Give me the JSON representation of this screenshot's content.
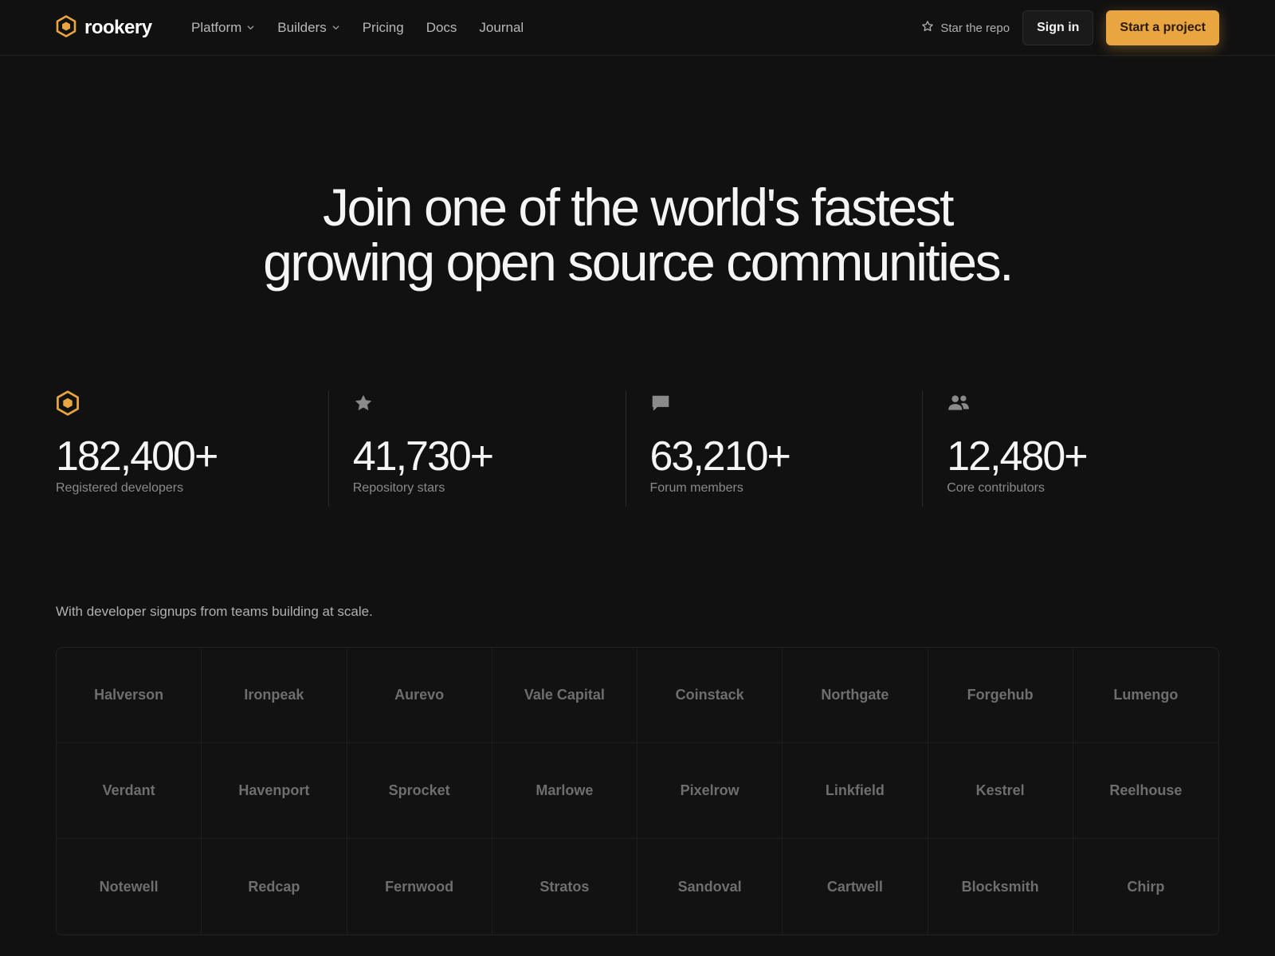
{
  "brand": {
    "name": "rookery",
    "accent": "#e9a53f"
  },
  "nav": {
    "links": [
      {
        "label": "Platform",
        "has_dropdown": true
      },
      {
        "label": "Builders",
        "has_dropdown": true
      },
      {
        "label": "Pricing",
        "has_dropdown": false
      },
      {
        "label": "Docs",
        "has_dropdown": false
      },
      {
        "label": "Journal",
        "has_dropdown": false
      }
    ],
    "star_label": "Star the repo",
    "signin_label": "Sign in",
    "cta_label": "Start a project"
  },
  "hero": {
    "line1": "Join one of the world's fastest",
    "line2": "growing open source communities."
  },
  "stats": [
    {
      "icon": "hexagon-logo-icon",
      "value": "182,400+",
      "label": "Registered developers"
    },
    {
      "icon": "star-icon",
      "value": "41,730+",
      "label": "Repository stars"
    },
    {
      "icon": "chat-bubble-icon",
      "value": "63,210+",
      "label": "Forum members"
    },
    {
      "icon": "users-icon",
      "value": "12,480+",
      "label": "Core contributors"
    }
  ],
  "logos": {
    "caption": "With developer signups from teams building at scale.",
    "items": [
      "Halverson",
      "Ironpeak",
      "Aurevo",
      "Vale Capital",
      "Coinstack",
      "Northgate",
      "Forgehub",
      "Lumengo",
      "Verdant",
      "Havenport",
      "Sprocket",
      "Marlowe",
      "Pixelrow",
      "Linkfield",
      "Kestrel",
      "Reelhouse",
      "Notewell",
      "Redcap",
      "Fernwood",
      "Stratos",
      "Sandoval",
      "Cartwell",
      "Blocksmith",
      "Chirp"
    ]
  }
}
